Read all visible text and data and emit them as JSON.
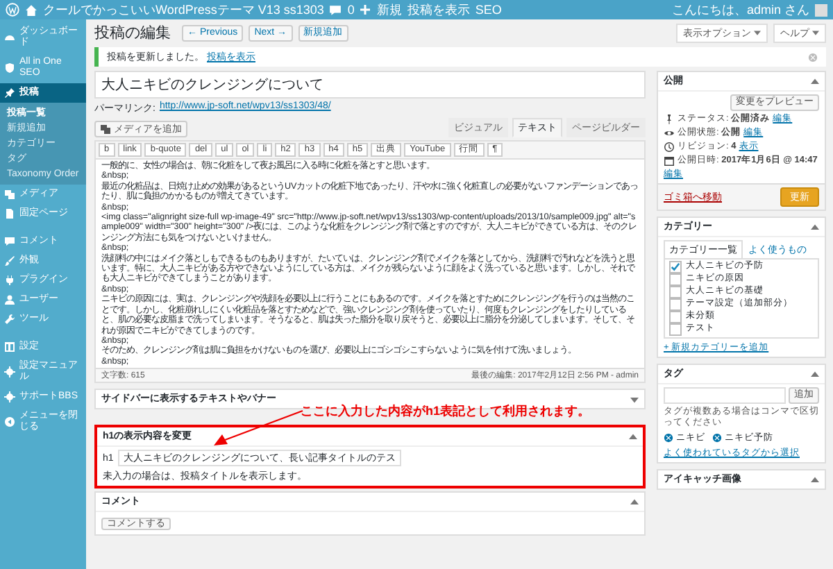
{
  "admin_bar": {
    "site_title": "クールでかっこいいWordPressテーマ V13 ss1303",
    "comment_count": "0",
    "new_label": "新規",
    "view_post": "投稿を表示",
    "seo": "SEO",
    "greeting": "こんにちは、admin さん"
  },
  "menu": [
    {
      "label": "ダッシュボード",
      "selected": false
    },
    {
      "label": "All in One SEO",
      "selected": false
    },
    {
      "label": "投稿",
      "selected": true,
      "children": [
        {
          "label": "投稿一覧",
          "selected": true
        },
        {
          "label": "新規追加",
          "selected": false
        },
        {
          "label": "カテゴリー",
          "selected": false
        },
        {
          "label": "タグ",
          "selected": false
        },
        {
          "label": "Taxonomy Order",
          "selected": false
        }
      ]
    },
    {
      "label": "メディア",
      "selected": false
    },
    {
      "label": "固定ページ",
      "selected": false
    },
    {
      "label": "コメント",
      "selected": false
    },
    {
      "label": "外観",
      "selected": false
    },
    {
      "label": "プラグイン",
      "selected": false
    },
    {
      "label": "ユーザー",
      "selected": false
    },
    {
      "label": "ツール",
      "selected": false
    },
    {
      "label": "設定",
      "selected": false
    },
    {
      "label": "設定マニュアル",
      "selected": false
    },
    {
      "label": "サポートBBS",
      "selected": false
    },
    {
      "label": "メニューを閉じる",
      "selected": false
    }
  ],
  "screen_options": [
    "表示オプション",
    "ヘルプ"
  ],
  "heading": {
    "title": "投稿の編集",
    "buttons": [
      "← Previous",
      "Next →",
      "新規追加"
    ]
  },
  "notice": {
    "text": "投稿を更新しました。",
    "link": "投稿を表示"
  },
  "editor": {
    "title": "大人ニキビのクレンジングについて",
    "permalink_label": "パーマリンク:",
    "permalink": "http://www.jp-soft.net/wpv13/ss1303/48/",
    "media_button": "メディアを追加",
    "tabs": [
      {
        "label": "ビジュアル",
        "selected": false
      },
      {
        "label": "テキスト",
        "selected": true
      },
      {
        "label": "ページビルダー",
        "selected": false
      }
    ],
    "quicktags": [
      "b",
      "link",
      "b-quote",
      "del",
      "ul",
      "ol",
      "li",
      "h2",
      "h3",
      "h4",
      "h5",
      "出典",
      "YouTube",
      "行間",
      "¶"
    ],
    "lines": [
      "一般的に、女性の場合は、朝に化粧をして夜お風呂に入る時に化粧を落とすと思います。",
      "&nbsp;",
      "最近の化粧品は、日焼け止めの効果があるというUVカットの化粧下地であったり、汗や水に強く化粧直しの必要がないファンデーションであったり、肌に負担のかかるものが増えてきています。",
      "&nbsp;",
      "<img class=\"alignright size-full wp-image-49\" src=\"http://www.jp-soft.net/wpv13/ss1303/wp-content/uploads/2013/10/sample009.jpg\" alt=\"sample009\" width=\"300\" height=\"300\" />夜には、このような化粧をクレンジング剤で落とすのですが、大人ニキビができている方は、そのクレンジング方法にも気をつけないといけません。",
      "&nbsp;",
      "洗顔料の中にはメイク落としもできるものもありますが、たいていは、クレンジング剤でメイクを落としてから、洗顔料で汚れなどを洗うと思います。特に、大人ニキビがある方やできないようにしている方は、メイクが残らないように顔をよく洗っていると思います。しかし、それでも大人ニキビができてしまうことがあります。",
      "&nbsp;",
      "ニキビの原因には、実は、クレンジングや洗顔を必要以上に行うことにもあるのです。メイクを落とすためにクレンジングを行うのは当然のことです。しかし、化粧崩れしにくい化粧品を落とすためなどで、強いクレンジング剤を使っていたり、何度もクレンジングをしたりしていると、肌の必要な皮脂まで洗ってしまいます。そうなると、肌は失った脂分を取り戻そうと、必要以上に脂分を分泌してしまいます。そして、それが原因でニキビができてしまうのです。",
      "&nbsp;",
      "そのため、クレンジング剤は肌に負担をかけないものを選び、必要以上にゴシゴシこすらないように気を付けて洗いましょう。",
      "&nbsp;"
    ],
    "word_count": "文字数: 615",
    "last_edited": "最後の編集: 2017年2月12日 2:56 PM - admin"
  },
  "sidebar_box": {
    "title": "サイドバーに表示するテキストやバナー",
    "expanded": false
  },
  "annotation": {
    "text": "ここに入力した内容がh1表記として利用されます。"
  },
  "h1_box": {
    "title": "h1の表示内容を変更",
    "expanded": true,
    "highlighted": true,
    "label": "h1",
    "value": "大人ニキビのクレンジングについて、長い記事タイトルのテス",
    "note": "未入力の場合は、投稿タイトルを表示します。"
  },
  "comment_box": {
    "title": "コメント",
    "expanded": true,
    "button": "コメントする"
  },
  "publish": {
    "title": "公開",
    "expanded": true,
    "preview_button": "変更をプレビュー",
    "rows": [
      {
        "text": "ステータス: **公開済み**",
        "link": "編集"
      },
      {
        "text": "公開状態: **公開**",
        "link": "編集"
      },
      {
        "text": "リビジョン: **4**",
        "link": "表示"
      },
      {
        "text": "公開日時: **2017年1月6日 @ 14:47**",
        "link": "編集"
      }
    ],
    "trash_link": "ゴミ箱へ移動",
    "update_button": "更新"
  },
  "categories": {
    "title": "カテゴリー",
    "expanded": true,
    "tabs": [
      {
        "label": "カテゴリー一覧",
        "selected": true
      },
      {
        "label": "よく使うもの",
        "selected": false
      }
    ],
    "items": [
      {
        "label": "大人ニキビの予防",
        "checked": true
      },
      {
        "label": "ニキビの原因",
        "checked": false
      },
      {
        "label": "大人ニキビの基礎",
        "checked": false
      },
      {
        "label": "テーマ設定（追加部分）",
        "checked": false
      },
      {
        "label": "未分類",
        "checked": false
      },
      {
        "label": "テスト",
        "checked": false
      }
    ],
    "add_link": "+ 新規カテゴリーを追加"
  },
  "tags": {
    "title": "タグ",
    "expanded": true,
    "add_button": "追加",
    "hint": "タグが複数ある場合はコンマで区切ってください",
    "items": [
      "ニキビ",
      "ニキビ予防"
    ],
    "choose_link": "よく使われているタグから選択"
  },
  "featured_image": {
    "title": "アイキャッチ画像",
    "expanded": true
  }
}
